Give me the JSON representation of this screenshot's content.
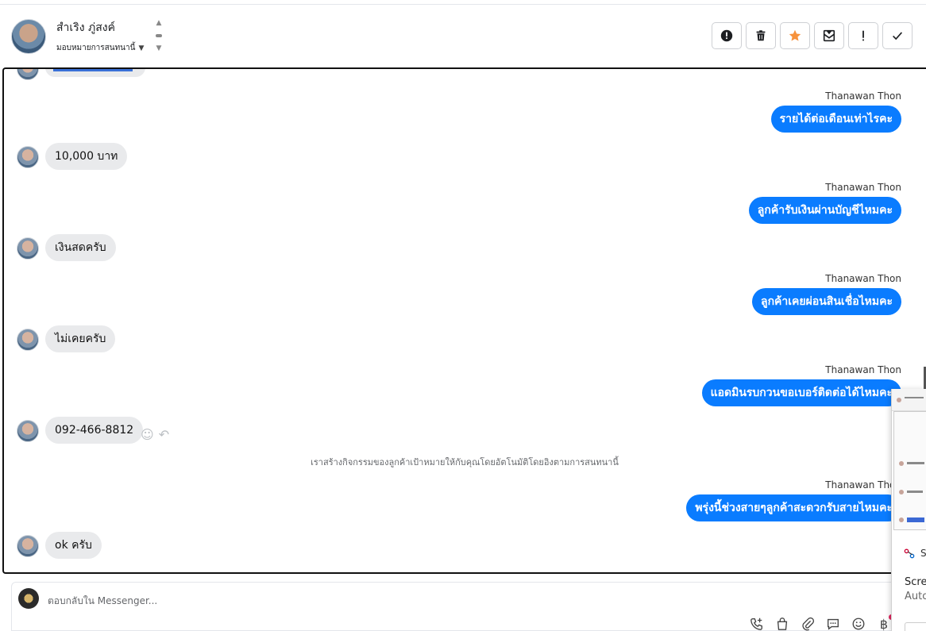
{
  "header": {
    "contact_name": "สำเริง ภู่สงค์",
    "assign_label": "มอบหมายการสนทนานี้",
    "actions": [
      {
        "name": "spam-button",
        "icon": "alert-circle-icon"
      },
      {
        "name": "delete-button",
        "icon": "trash-icon"
      },
      {
        "name": "star-button",
        "icon": "star-icon"
      },
      {
        "name": "mark-unread-button",
        "icon": "envelope-icon"
      },
      {
        "name": "important-button",
        "icon": "exclamation-icon"
      },
      {
        "name": "done-button",
        "icon": "check-icon"
      }
    ]
  },
  "conversation": {
    "messages": [
      {
        "type": "out",
        "sender": "Thanawan Thon",
        "text": "รายได้ต่อเดือนเท่าไรคะ"
      },
      {
        "type": "in",
        "text": "10,000 บาท"
      },
      {
        "type": "out",
        "sender": "Thanawan Thon",
        "text": "ลูกค้ารับเงินผ่านบัญชีไหมคะ"
      },
      {
        "type": "in",
        "text": "เงินสดครับ"
      },
      {
        "type": "out",
        "sender": "Thanawan Thon",
        "text": "ลูกค้าเคยผ่อนสินเชื่อไหมคะ"
      },
      {
        "type": "in",
        "text": "ไม่เคยครับ"
      },
      {
        "type": "out",
        "sender": "Thanawan Thon",
        "text": "แอดมินรบกวนขอเบอร์ติดต่อได้ไหมคะ"
      },
      {
        "type": "in",
        "text": "092-466-8812"
      },
      {
        "type": "out",
        "sender": "Thanawan Thon",
        "text": "พรุ่งนี้ช่วงสายๆลูกค้าสะดวกรับสายไหมคะ"
      },
      {
        "type": "in",
        "text": "ok ครับ"
      }
    ],
    "system_note": "เราสร้างกิจกรรมของลูกค้าเป้าหมายให้กับคุณโดยอัตโนมัติโดยอิงตามการสนทนานี้"
  },
  "composer": {
    "placeholder": "ตอบกลับใน Messenger...",
    "tools": [
      "phone-plus-icon",
      "shopping-bag-icon",
      "paperclip-icon",
      "chat-bubble-icon",
      "smiley-icon",
      "baht-icon"
    ]
  },
  "overlay": {
    "title": "S",
    "line1": "Scree",
    "line2": "Auto"
  },
  "colors": {
    "outgoing_bubble": "#0a7cff",
    "incoming_bubble": "#e9eaec",
    "star": "#f7923b"
  }
}
